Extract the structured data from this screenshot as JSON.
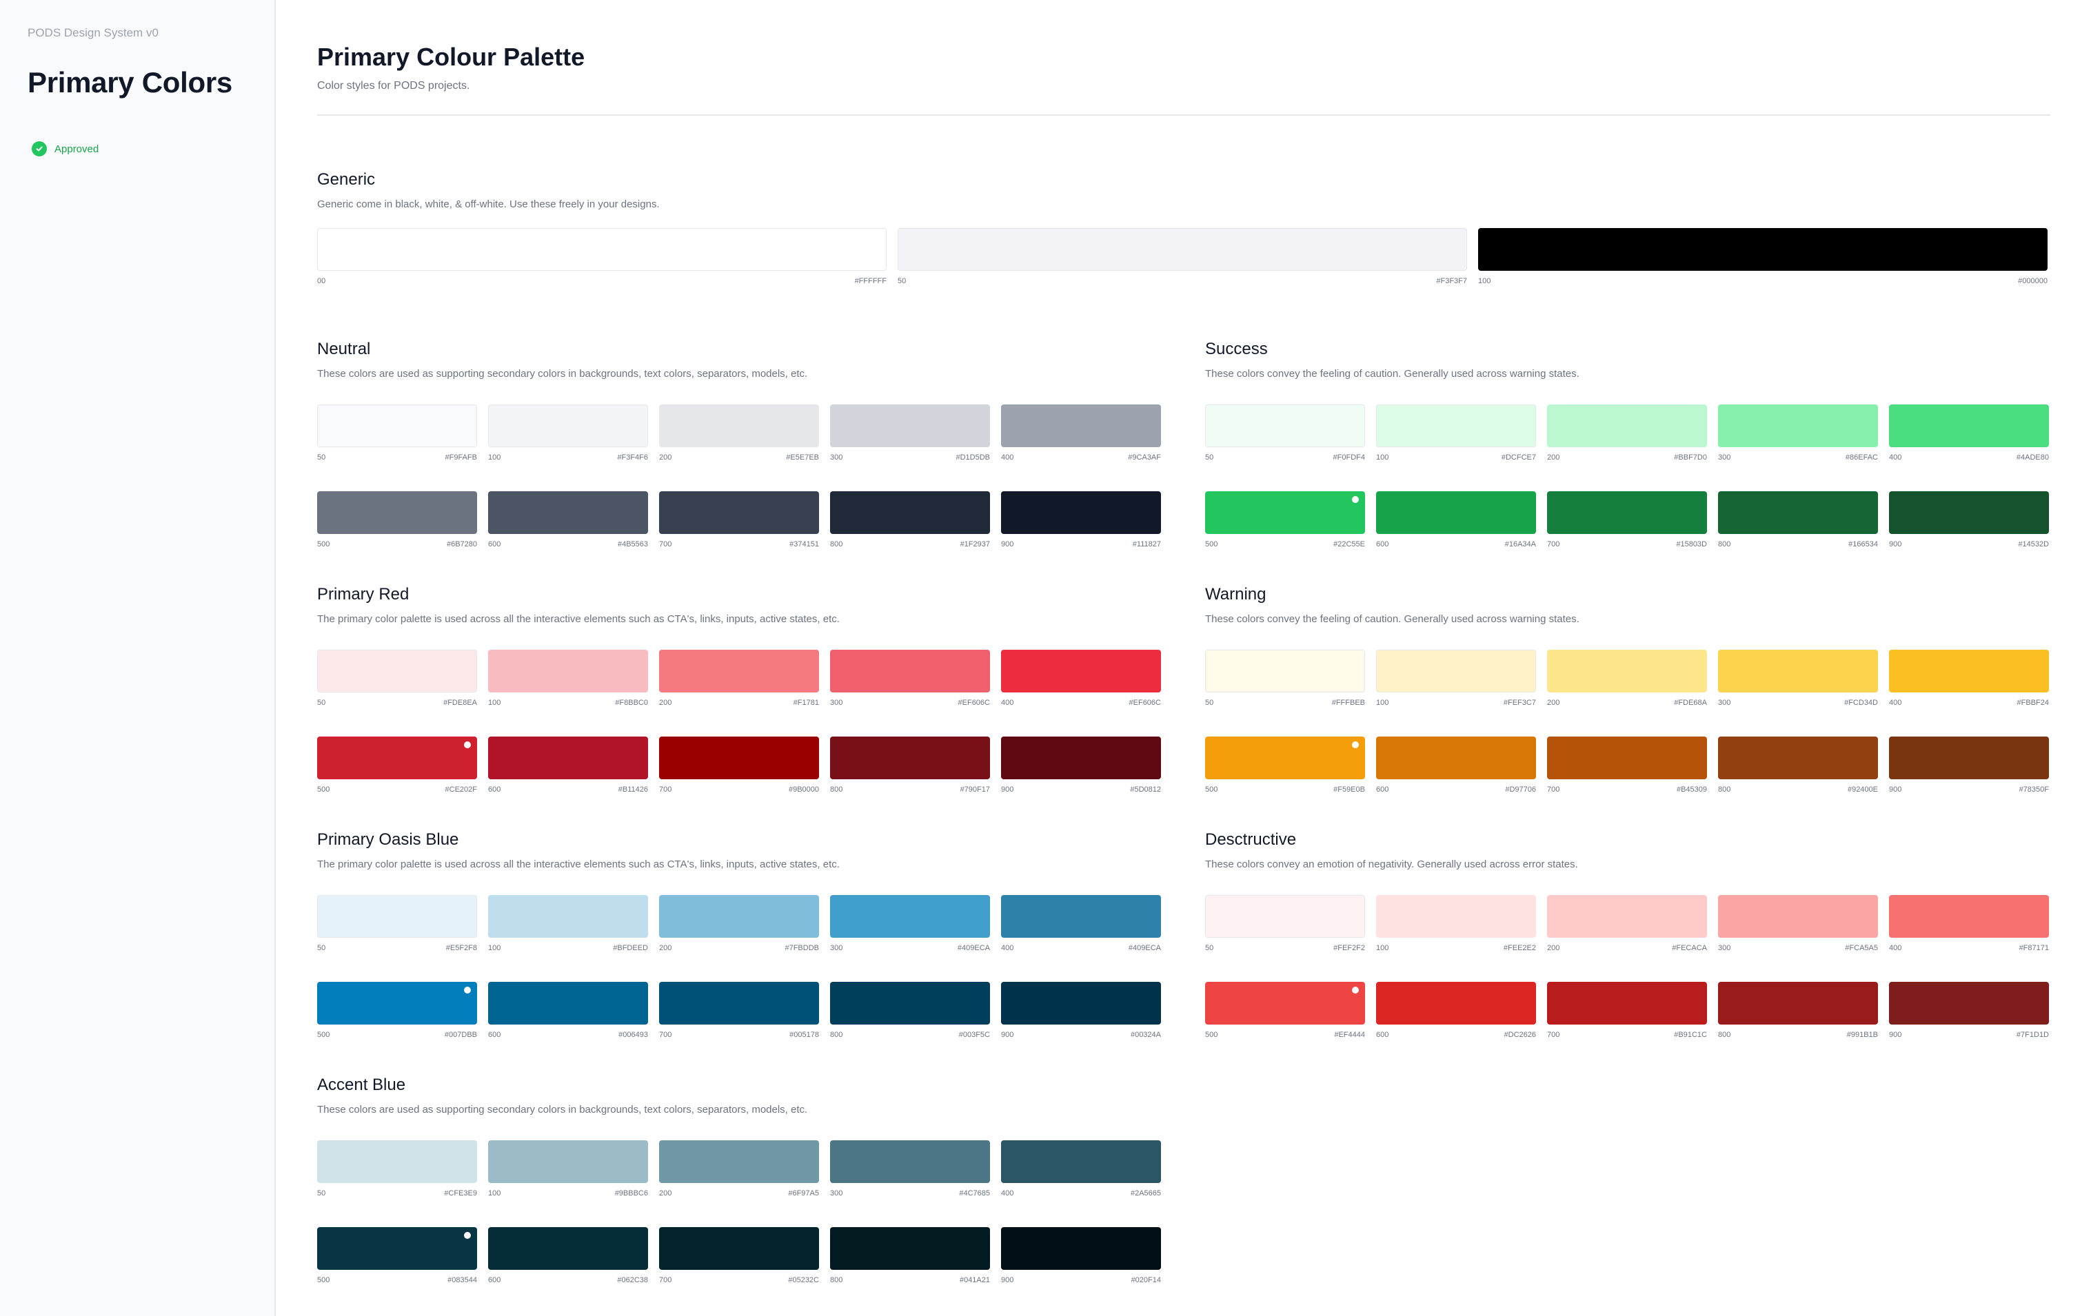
{
  "sidebar": {
    "overline": "PODS Design System v0",
    "title": "Primary Colors",
    "badge": {
      "label": "Approved",
      "icon": "check-circle-icon",
      "color": "#22C55E"
    }
  },
  "header": {
    "title": "Primary Colour Palette",
    "subtitle": "Color styles for PODS projects."
  },
  "generic": {
    "title": "Generic",
    "description": "Generic come in black, white, & off-white. Use these freely in your designs.",
    "swatches": [
      {
        "step": "00",
        "hex": "#FFFFFF"
      },
      {
        "step": "50",
        "hex": "#F3F3F7"
      },
      {
        "step": "100",
        "hex": "#000000"
      }
    ]
  },
  "palettes": {
    "neutral": {
      "title": "Neutral",
      "description": "These colors are used as supporting secondary colors in backgrounds, text colors, separators, models, etc.",
      "swatches": [
        {
          "step": "50",
          "hex": "#F9FAFB"
        },
        {
          "step": "100",
          "hex": "#F3F4F6"
        },
        {
          "step": "200",
          "hex": "#E5E7EB"
        },
        {
          "step": "300",
          "hex": "#D1D5DB"
        },
        {
          "step": "400",
          "hex": "#9CA3AF"
        },
        {
          "step": "500",
          "hex": "#6B7280"
        },
        {
          "step": "600",
          "hex": "#4B5563"
        },
        {
          "step": "700",
          "hex": "#374151"
        },
        {
          "step": "800",
          "hex": "#1F2937"
        },
        {
          "step": "900",
          "hex": "#111827"
        }
      ]
    },
    "success": {
      "title": "Success",
      "description": "These colors convey the feeling of caution. Generally used across warning states.",
      "swatches": [
        {
          "step": "50",
          "hex": "#F0FDF4"
        },
        {
          "step": "100",
          "hex": "#DCFCE7"
        },
        {
          "step": "200",
          "hex": "#BBF7D0"
        },
        {
          "step": "300",
          "hex": "#86EFAC"
        },
        {
          "step": "400",
          "hex": "#4ADE80"
        },
        {
          "step": "500",
          "hex": "#22C55E"
        },
        {
          "step": "600",
          "hex": "#16A34A"
        },
        {
          "step": "700",
          "hex": "#15803D"
        },
        {
          "step": "800",
          "hex": "#166534"
        },
        {
          "step": "900",
          "hex": "#14532D"
        }
      ]
    },
    "primary_red": {
      "title": "Primary Red",
      "description": "The primary color palette is used across all the interactive elements such as CTA's, links, inputs, active states, etc.",
      "swatches": [
        {
          "step": "50",
          "hex": "#FDE8EA"
        },
        {
          "step": "100",
          "hex": "#F8BBC0"
        },
        {
          "step": "200",
          "hex": "#F1781"
        },
        {
          "step": "300",
          "hex": "#EF606C"
        },
        {
          "step": "400",
          "hex": "#EF606C"
        },
        {
          "step": "500",
          "hex": "#CE202F"
        },
        {
          "step": "600",
          "hex": "#B11426"
        },
        {
          "step": "700",
          "hex": "#9B0000"
        },
        {
          "step": "800",
          "hex": "#790F17"
        },
        {
          "step": "900",
          "hex": "#5D0812"
        }
      ],
      "display_colors": [
        "#FDE8EA",
        "#F8BBC0",
        "#F47A7F",
        "#EF606C",
        "#EE2C3F",
        "#CE202F",
        "#B11426",
        "#9B0000",
        "#790F17",
        "#5D0812"
      ]
    },
    "warning": {
      "title": "Warning",
      "description": "These colors convey the feeling of caution. Generally used across warning states.",
      "swatches": [
        {
          "step": "50",
          "hex": "#FFFBEB"
        },
        {
          "step": "100",
          "hex": "#FEF3C7"
        },
        {
          "step": "200",
          "hex": "#FDE68A"
        },
        {
          "step": "300",
          "hex": "#FCD34D"
        },
        {
          "step": "400",
          "hex": "#FBBF24"
        },
        {
          "step": "500",
          "hex": "#F59E0B"
        },
        {
          "step": "600",
          "hex": "#D97706"
        },
        {
          "step": "700",
          "hex": "#B45309"
        },
        {
          "step": "800",
          "hex": "#92400E"
        },
        {
          "step": "900",
          "hex": "#78350F"
        }
      ]
    },
    "oasis_blue": {
      "title": "Primary Oasis Blue",
      "description": "The primary color palette is used across all the interactive elements such as CTA's, links, inputs, active states, etc.",
      "swatches": [
        {
          "step": "50",
          "hex": "#E5F2F8"
        },
        {
          "step": "100",
          "hex": "#BFDEED"
        },
        {
          "step": "200",
          "hex": "#7FBDDB"
        },
        {
          "step": "300",
          "hex": "#409ECA"
        },
        {
          "step": "400",
          "hex": "#409ECA"
        },
        {
          "step": "500",
          "hex": "#007DBB"
        },
        {
          "step": "600",
          "hex": "#006493"
        },
        {
          "step": "700",
          "hex": "#005178"
        },
        {
          "step": "800",
          "hex": "#003F5C"
        },
        {
          "step": "900",
          "hex": "#00324A"
        }
      ],
      "display_colors": [
        "#E5F2F8",
        "#BFDEED",
        "#7FBDDB",
        "#409ECA",
        "#2E82AA",
        "#007DBB",
        "#006493",
        "#005178",
        "#003F5C",
        "#00324A"
      ]
    },
    "destructive": {
      "title": "Desctructive",
      "description": "These colors convey an emotion of negativity. Generally used across error states.",
      "swatches": [
        {
          "step": "50",
          "hex": "#FEF2F2"
        },
        {
          "step": "100",
          "hex": "#FEE2E2"
        },
        {
          "step": "200",
          "hex": "#FECACA"
        },
        {
          "step": "300",
          "hex": "#FCA5A5"
        },
        {
          "step": "400",
          "hex": "#F87171"
        },
        {
          "step": "500",
          "hex": "#EF4444"
        },
        {
          "step": "600",
          "hex": "#DC2626"
        },
        {
          "step": "700",
          "hex": "#B91C1C"
        },
        {
          "step": "800",
          "hex": "#991B1B"
        },
        {
          "step": "900",
          "hex": "#7F1D1D"
        }
      ]
    },
    "accent_blue": {
      "title": "Accent Blue",
      "description": "These colors are used as supporting secondary colors in backgrounds, text colors, separators, models, etc.",
      "swatches": [
        {
          "step": "50",
          "hex": "#CFE3E9"
        },
        {
          "step": "100",
          "hex": "#9BBBC6"
        },
        {
          "step": "200",
          "hex": "#6F97A5"
        },
        {
          "step": "300",
          "hex": "#4C7685"
        },
        {
          "step": "400",
          "hex": "#2A5665"
        },
        {
          "step": "500",
          "hex": "#083544"
        },
        {
          "step": "600",
          "hex": "#062C38"
        },
        {
          "step": "700",
          "hex": "#05232C"
        },
        {
          "step": "800",
          "hex": "#041A21"
        },
        {
          "step": "900",
          "hex": "#020F14"
        }
      ]
    }
  }
}
